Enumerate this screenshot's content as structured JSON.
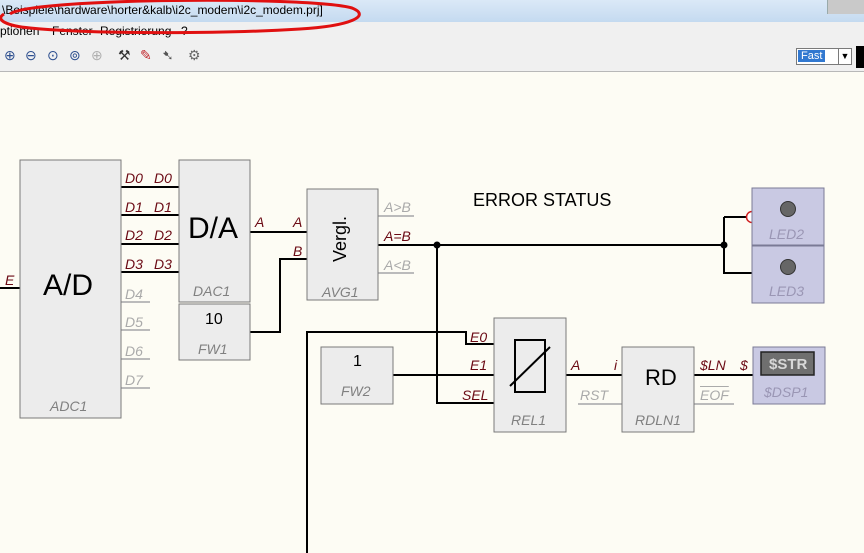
{
  "window": {
    "title": "\\Beispiele\\hardware\\horter&kalb\\i2c_modem\\i2c_modem.prj]"
  },
  "menu": {
    "items": [
      "ptionen",
      "Fenster",
      "Registrierung",
      "?"
    ]
  },
  "toolbar": {
    "icons": [
      "zoom-in-icon",
      "zoom-out-icon",
      "zoom-fit-icon",
      "zoom-page-icon",
      "zoom-disabled-icon",
      "tools-icon",
      "probe-icon",
      "connect-icon",
      "gear-icon"
    ],
    "speed": "Fast",
    "speed_arrow": "▼"
  },
  "annotation": {
    "color": "#e01010"
  },
  "diagram": {
    "adc": {
      "label": "A/D",
      "name": "ADC1",
      "input": "E"
    },
    "dac": {
      "label": "D/A",
      "name": "DAC1",
      "output": "A"
    },
    "port_pairs": [
      {
        "out": "D0",
        "in": "D0"
      },
      {
        "out": "D1",
        "in": "D1"
      },
      {
        "out": "D2",
        "in": "D2"
      },
      {
        "out": "D3",
        "in": "D3"
      }
    ],
    "adc_unused": [
      "D4",
      "D5",
      "D6",
      "D7"
    ],
    "fw1": {
      "value": "10",
      "name": "FW1"
    },
    "avg": {
      "label": "Vergl.",
      "name": "AVG1",
      "in_a": "A",
      "in_b": "B",
      "out_gt": "A>B",
      "out_eq": "A=B",
      "out_lt": "A<B"
    },
    "error_status": "ERROR STATUS",
    "led2": {
      "name": "LED2"
    },
    "led3": {
      "name": "LED3"
    },
    "fw2": {
      "value": "1",
      "name": "FW2"
    },
    "rel": {
      "name": "REL1",
      "in_e0": "E0",
      "in_e1": "E1",
      "in_sel": "SEL",
      "out": "A"
    },
    "rdln": {
      "label": "RD",
      "name": "RDLN1",
      "in_i": "i",
      "in_rst": "RST",
      "out_ln": "$LN",
      "out_eof": "EOF"
    },
    "dsp": {
      "input": "$",
      "display": "$STR",
      "name": "$DSP1"
    },
    "colors": {
      "wire": "#000000",
      "port": "#6b0a14",
      "unused": "#aaaaaa",
      "block_fill": "#ececec",
      "led_fill": "#c9c9e3",
      "display_fill": "#6f6f6f"
    }
  }
}
